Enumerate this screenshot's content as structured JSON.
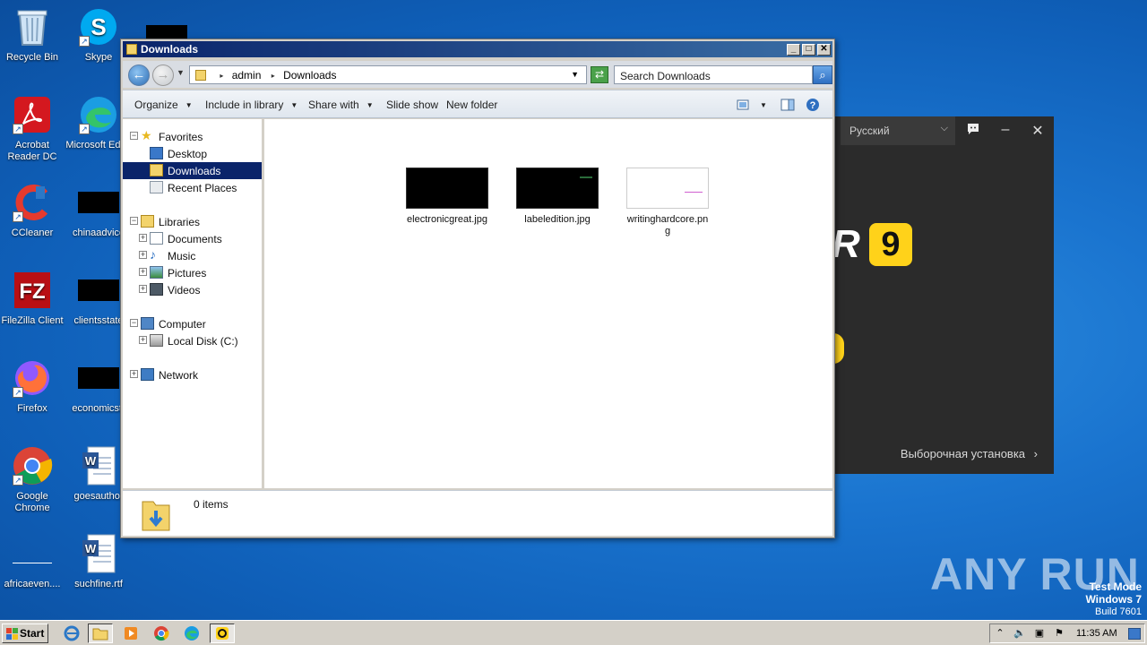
{
  "desktop": {
    "icons": [
      {
        "label": "Recycle Bin"
      },
      {
        "label": "Skype"
      },
      {
        "label": "Acrobat Reader DC"
      },
      {
        "label": "Microsoft Edge"
      },
      {
        "label": "CCleaner"
      },
      {
        "label": "chinaadvice"
      },
      {
        "label": "FileZilla Client"
      },
      {
        "label": "clientsstate"
      },
      {
        "label": "Firefox"
      },
      {
        "label": "economicstr"
      },
      {
        "label": "Google Chrome"
      },
      {
        "label": "goesauthor"
      },
      {
        "label": "africaeven...."
      },
      {
        "label": "suchfine.rtf"
      }
    ]
  },
  "installer": {
    "language": "Русский",
    "brand_letter": "R",
    "version_badge": "9",
    "custom_install": "Выборочная установка"
  },
  "explorer": {
    "title": "Downloads",
    "address": {
      "segments": [
        "admin",
        "Downloads"
      ]
    },
    "search_placeholder": "Search Downloads",
    "toolbar": {
      "organize": "Organize",
      "include_in_library": "Include in library",
      "share_with": "Share with",
      "slide_show": "Slide show",
      "new_folder": "New folder"
    },
    "nav": {
      "favorites": "Favorites",
      "desktop": "Desktop",
      "downloads": "Downloads",
      "recent_places": "Recent Places",
      "libraries": "Libraries",
      "documents": "Documents",
      "music": "Music",
      "pictures": "Pictures",
      "videos": "Videos",
      "computer": "Computer",
      "local_disk": "Local Disk (C:)",
      "network": "Network"
    },
    "files": [
      {
        "name": "electronicgreat.jpg"
      },
      {
        "name": "labeledition.jpg"
      },
      {
        "name": "writinghardcore.png"
      }
    ],
    "details": {
      "count": "0 items"
    }
  },
  "watermark": {
    "text": "ANY RUN"
  },
  "test_mode": {
    "line1": "Test Mode",
    "line2": "Windows 7",
    "line3": "Build 7601"
  },
  "taskbar": {
    "start": "Start",
    "clock": "11:35 AM"
  }
}
